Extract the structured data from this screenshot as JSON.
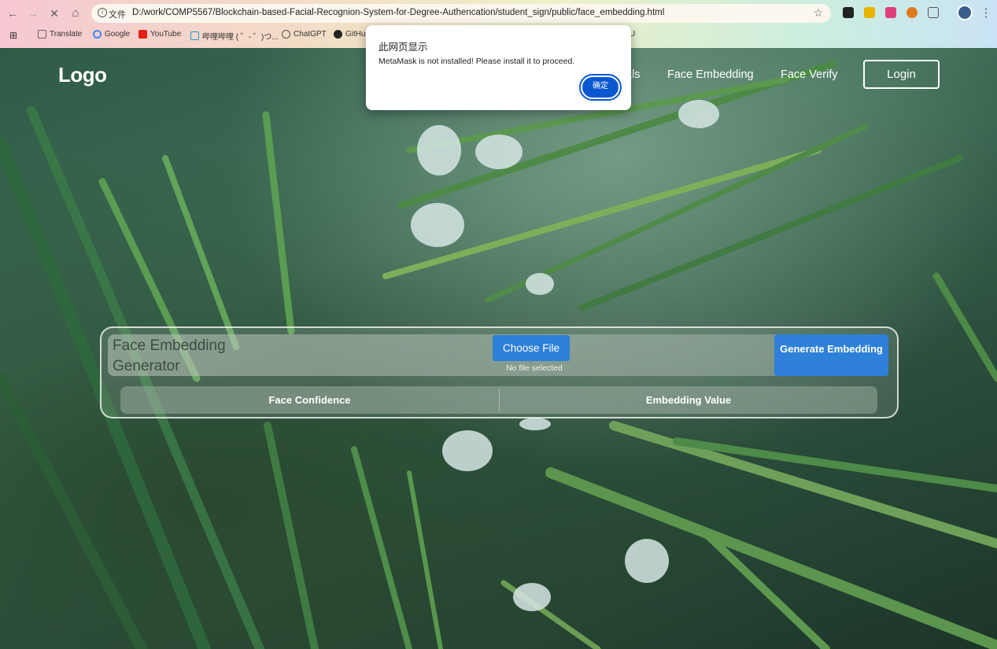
{
  "browser": {
    "nav": {
      "back": "←",
      "forward": "→",
      "stop": "✕",
      "home": "⌂"
    },
    "address": {
      "scheme_label": "文件",
      "url": "D:/work/COMP5567/Blockchain-based-Facial-Recognion-System-for-Degree-Authencation/student_sign/public/face_embedding.html",
      "star": "☆"
    },
    "menu": "⋮",
    "bookmarks": {
      "apps": "⊞",
      "items": [
        "Translate",
        "Google",
        "YouTube",
        "哔哩哔哩 ( ゜- ゜)つ...",
        "ChatGPT",
        "GitHu"
      ],
      "trailing": "U"
    }
  },
  "site": {
    "logo": "Logo",
    "nav": [
      {
        "label": "als"
      },
      {
        "label": "Face Embedding"
      },
      {
        "label": "Face Verify"
      }
    ],
    "login_label": "Login"
  },
  "generator": {
    "title": "Face Embedding Generator",
    "choose_file_label": "Choose File",
    "file_status": "No file selected",
    "generate_label": "Generate Embedding",
    "result_columns": [
      "Face Confidence",
      "Embedding Value"
    ]
  },
  "alert": {
    "title": "此网页显示",
    "message": "MetaMask is not installed! Please install it to proceed.",
    "ok_label": "确定"
  }
}
